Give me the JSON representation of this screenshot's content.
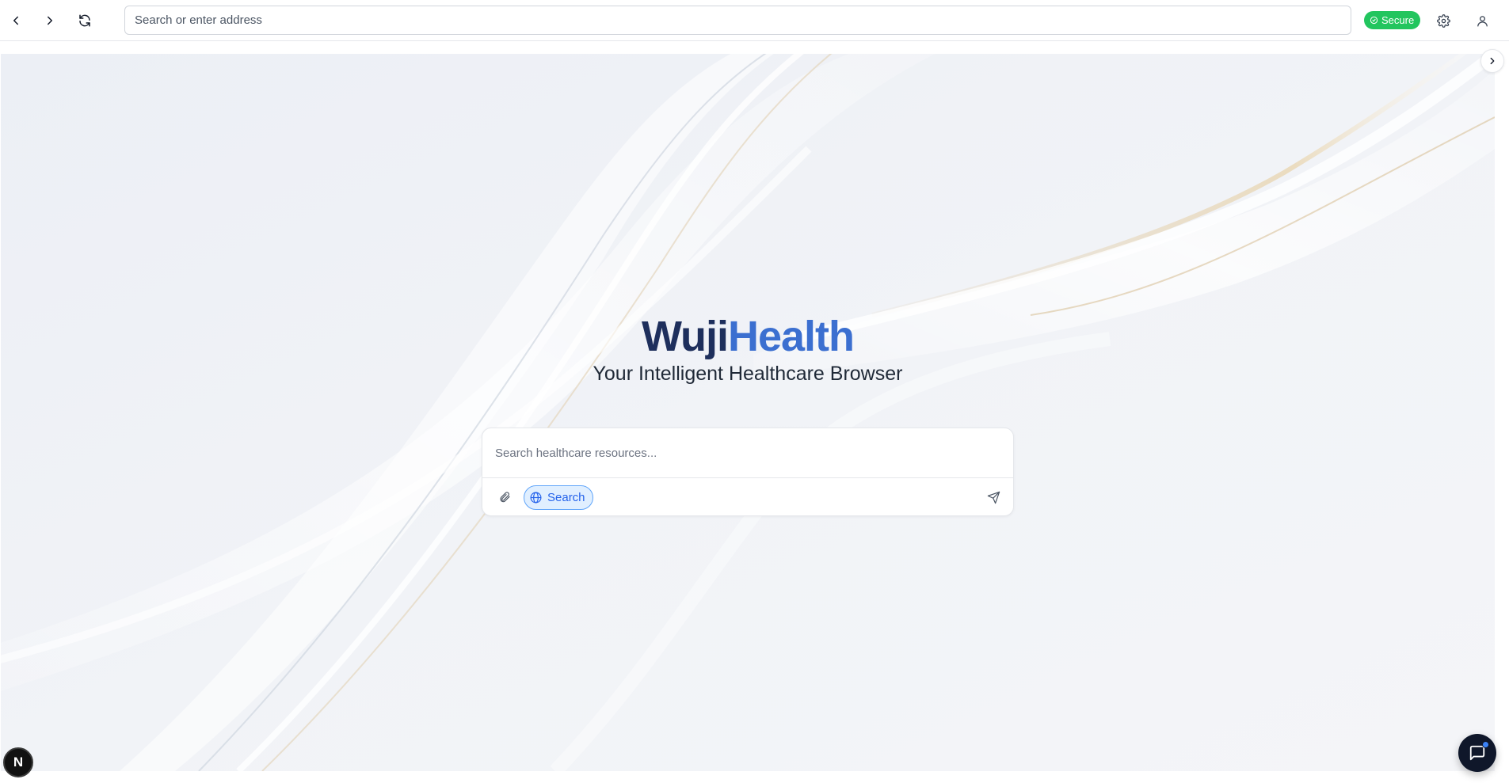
{
  "browser": {
    "address_placeholder": "Search or enter address",
    "secure_label": "Secure",
    "icons": {
      "back": "chevron-left-icon",
      "forward": "chevron-right-icon",
      "reload": "refresh-icon",
      "settings": "gear-icon",
      "profile": "user-icon"
    }
  },
  "hero": {
    "brand_part1": "Wuji",
    "brand_part2": "Health",
    "tagline": "Your Intelligent Healthcare Browser"
  },
  "search": {
    "placeholder": "Search healthcare resources...",
    "mode_label": "Search"
  },
  "fab": {
    "badge_letter": "N"
  },
  "colors": {
    "brand_dark": "#1e2f5c",
    "brand_blue": "#3b6fd0",
    "secure_green": "#22c55e",
    "search_pill_blue": "#2563eb"
  }
}
